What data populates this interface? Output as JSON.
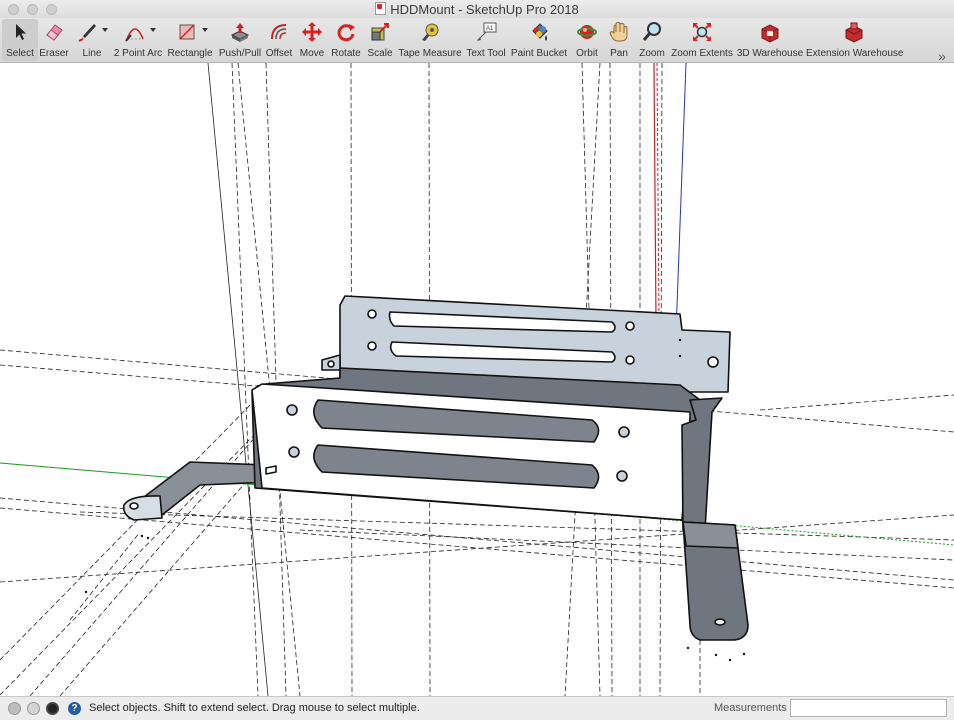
{
  "window": {
    "title": "HDDMount - SketchUp Pro 2018"
  },
  "toolbar": {
    "tools": [
      {
        "label": "Select",
        "icon": "select-arrow-icon",
        "selected": true
      },
      {
        "label": "Eraser",
        "icon": "eraser-icon"
      },
      {
        "label": "Line",
        "icon": "pencil-line-icon"
      },
      {
        "label": "2 Point Arc",
        "icon": "arc-icon"
      },
      {
        "label": "Rectangle",
        "icon": "rectangle-icon"
      },
      {
        "label": "Push/Pull",
        "icon": "push-pull-icon"
      },
      {
        "label": "Offset",
        "icon": "offset-icon"
      },
      {
        "label": "Move",
        "icon": "move-icon"
      },
      {
        "label": "Rotate",
        "icon": "rotate-icon"
      },
      {
        "label": "Scale",
        "icon": "scale-icon"
      },
      {
        "label": "Tape Measure",
        "icon": "tape-measure-icon"
      },
      {
        "label": "Text Tool",
        "icon": "text-tool-icon"
      },
      {
        "label": "Paint Bucket",
        "icon": "paint-bucket-icon"
      },
      {
        "label": "Orbit",
        "icon": "orbit-icon"
      },
      {
        "label": "Pan",
        "icon": "pan-hand-icon"
      },
      {
        "label": "Zoom",
        "icon": "zoom-icon"
      },
      {
        "label": "Zoom Extents",
        "icon": "zoom-extents-icon"
      },
      {
        "label": "3D Warehouse",
        "icon": "3d-warehouse-icon"
      },
      {
        "label": "Extension Warehouse",
        "icon": "extension-warehouse-icon"
      }
    ],
    "overflow_label": "»"
  },
  "status": {
    "message": "Select objects. Shift to extend select. Drag mouse to select multiple.",
    "measurements_label": "Measurements",
    "measurements_value": ""
  },
  "colors": {
    "toolbar_bg": "#dcdcdc",
    "viewport_bg": "#ffffff",
    "sheet_face": "#c8d2dc",
    "sheet_shadow": "#6f7680",
    "slot_fill": "#7e848d",
    "edge": "#111111",
    "axis_green": "#1a9a1a",
    "axis_red": "#cc2222",
    "axis_blue": "#2233cc"
  }
}
